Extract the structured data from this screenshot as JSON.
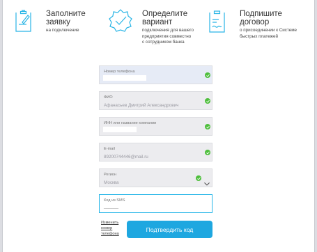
{
  "steps": [
    {
      "title": "Заполните\nзаявку",
      "desc": "на подключение",
      "icon": "clipboard-edit-icon"
    },
    {
      "title": "Определите\nвариант",
      "desc": "подключения для вашего\nпредприятия совместно\nс сотрудником банка",
      "icon": "badge-check-icon"
    },
    {
      "title": "Подпишите\nдоговор",
      "desc": "о присоединении к Системе\nбыстрых платежей",
      "icon": "clipboard-signature-icon"
    }
  ],
  "form": {
    "phone": {
      "label": "Номер телефона",
      "value": ""
    },
    "fio": {
      "label": "ФИО",
      "value": "Афанасьев Дмитрий Александрович"
    },
    "inn": {
      "label": "ИНН или название компании",
      "value": ""
    },
    "email": {
      "label": "E-mail",
      "value": "89200744446@mail.ru"
    },
    "region": {
      "label": "Регион",
      "value": "Москва"
    },
    "sms": {
      "label": "Код из SMS",
      "placeholder": "______"
    }
  },
  "change_phone_link": "Изменить\nномер\nтелефона",
  "confirm_button": "Подтвердить код",
  "colors": {
    "accent": "#1ea7e0",
    "valid": "#4fbf3d",
    "icon_stroke": "#29b5e6"
  }
}
